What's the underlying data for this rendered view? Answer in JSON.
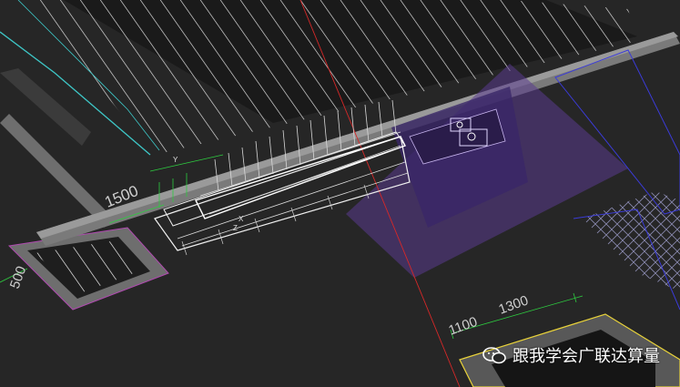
{
  "viewport": {
    "dimensions": [
      {
        "text": "1500"
      },
      {
        "text": "500"
      },
      {
        "text": "1100"
      },
      {
        "text": "1300"
      }
    ],
    "axis_labels": [
      {
        "text": "X"
      },
      {
        "text": "Y"
      },
      {
        "text": "Z"
      }
    ]
  },
  "colors": {
    "background": "#262626",
    "hatch": "#ffffff",
    "wall": "#6e6e6e",
    "selection": "#f0f0f0",
    "dimension": "#2ecc40",
    "axis_red": "#d62828",
    "purple_volume": "#5a3a8e",
    "cyan_edge": "#3ec7c7",
    "yellow_edge": "#e8d23a",
    "blue_edge": "#3b3bd8"
  },
  "watermark": {
    "text": "跟我学会广联达算量",
    "icon": "wechat-icon"
  }
}
